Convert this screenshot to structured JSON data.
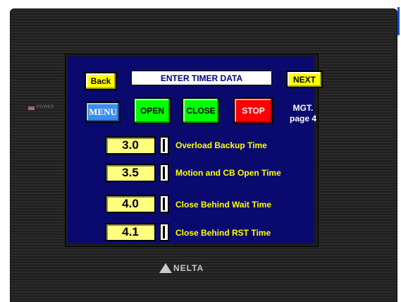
{
  "panel": {
    "power_label": "POWER",
    "brand": "NELTA"
  },
  "header": {
    "back_label": "Back",
    "title": "ENTER TIMER DATA",
    "next_label": "NEXT"
  },
  "controls": {
    "menu_label": "MENU",
    "open_label": "OPEN",
    "close_label": "CLOSE",
    "stop_label": "STOP",
    "page_line1": "MGT.",
    "page_line2": "page 4"
  },
  "timers": [
    {
      "value": "3.0",
      "label": "Overload Backup Time"
    },
    {
      "value": "3.5",
      "label": "Motion and CB  Open Time"
    },
    {
      "value": "4.0",
      "label": "Close Behind Wait Time"
    },
    {
      "value": "4.1",
      "label": "Close Behind RST Time"
    }
  ],
  "colors": {
    "screen_bg": "#0a0a6e",
    "yellow_button": "#ffff00",
    "menu_button": "#3b8df0",
    "open_button": "#00ff00",
    "close_button": "#00ff00",
    "stop_button": "#ff0000",
    "value_field": "#ffff80"
  }
}
